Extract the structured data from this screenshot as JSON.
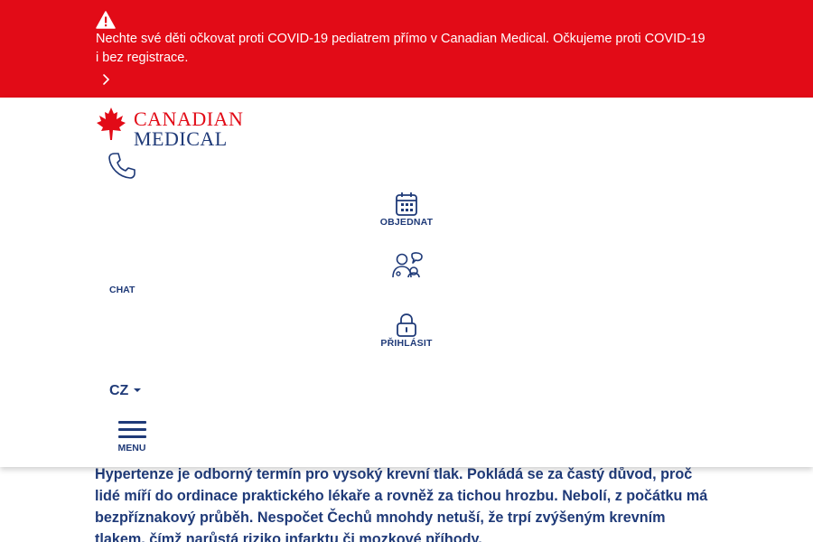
{
  "alert": {
    "icon": "warning-icon",
    "message": "Nechte své děti očkovat proti COVID-19 pediatrem přímo v Canadian Medical. Očkujeme proti COVID-19 i bez registrace.",
    "more_icon": "chevron-right-icon"
  },
  "header": {
    "logo": {
      "line1": "CANADIAN",
      "line2": "MEDICAL"
    },
    "phone_icon": "phone-icon",
    "nav": {
      "order_label": "OBJEDNAT",
      "chat_label": "CHAT",
      "login_label": "PŘIHLÁSIT"
    },
    "language": "CZ",
    "menu_label": "MENU"
  },
  "article": {
    "paragraph": "Hypertenze je odborný termín pro vysoký krevní tlak. Pokládá se za častý důvod, proč lidé míří do ordinace praktického lékaře a rovněž za tichou hrozbu. Nebolí, z počátku má bezpříznakový průběh.  Nespočet Čechů mnohdy netuší, že trpí zvýšeným krevním tlakem, čímž narůstá riziko infarktu či mozkové příhody."
  },
  "colors": {
    "brand_red": "#e20b17",
    "brand_blue": "#1f3a78",
    "background": "#ffffff"
  }
}
